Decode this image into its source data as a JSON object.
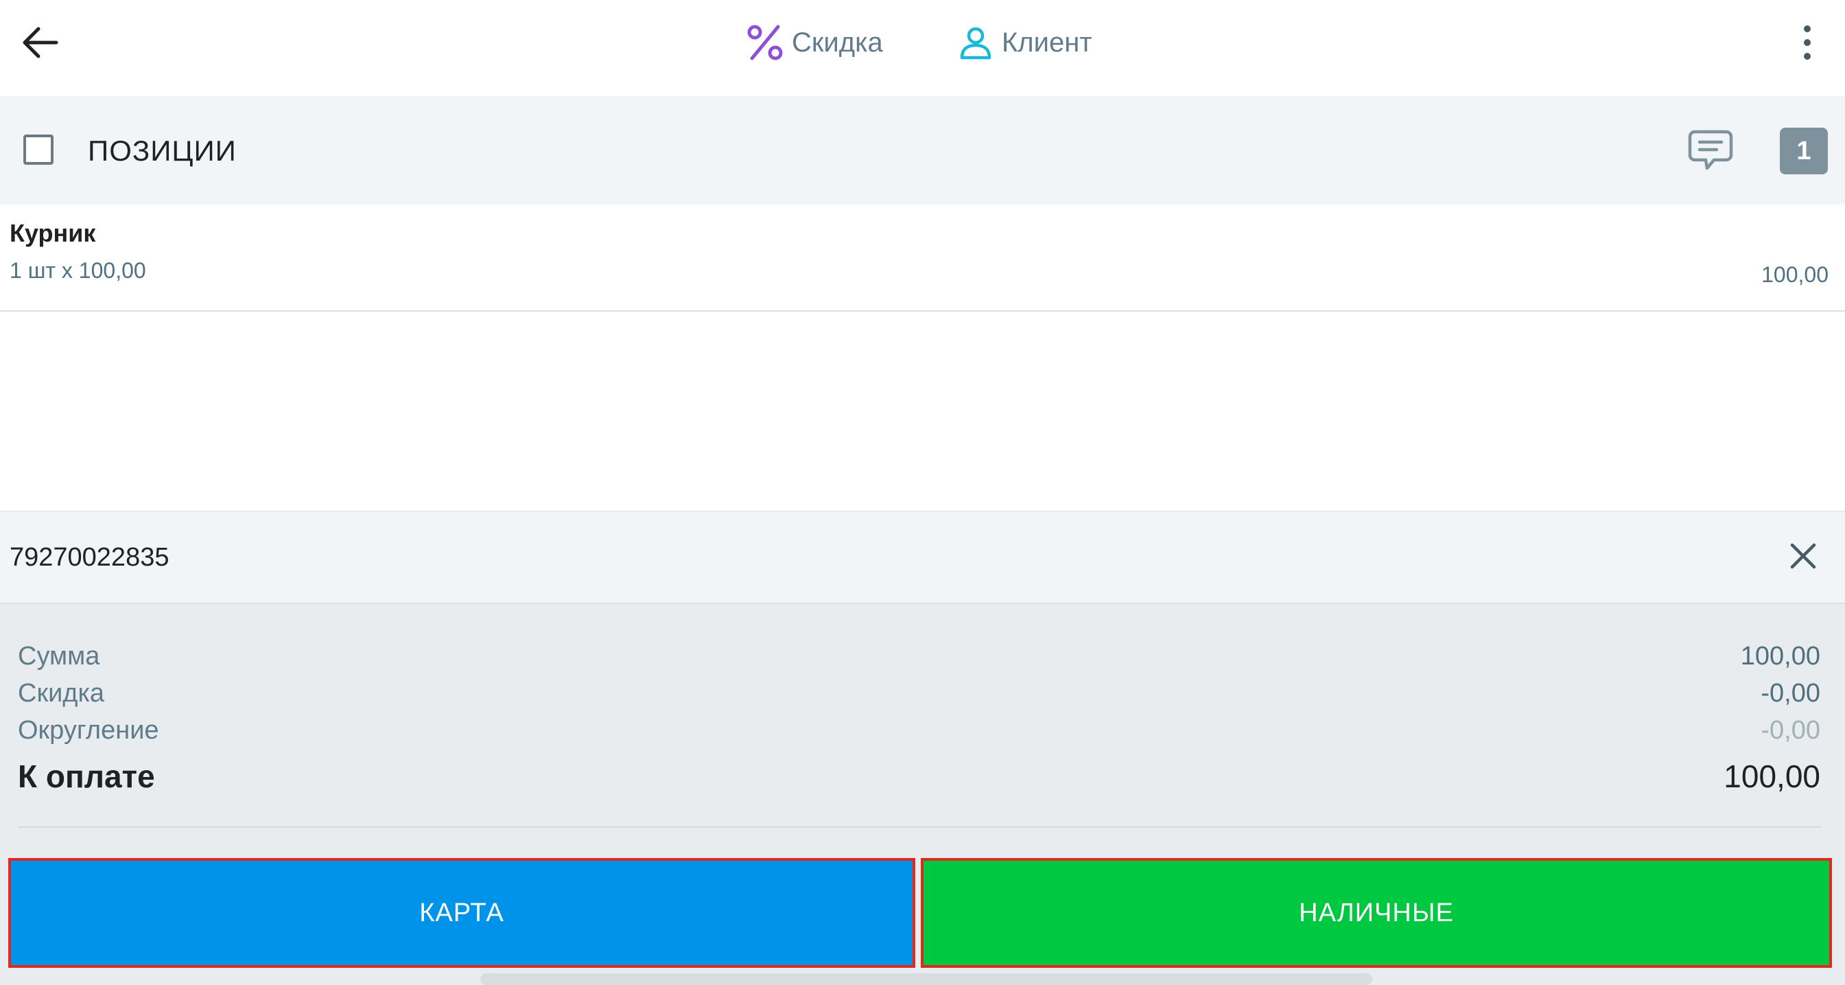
{
  "topbar": {
    "discount_label": "Скидка",
    "client_label": "Клиент",
    "icons": {
      "back": "arrow-left-icon",
      "discount": "percent-icon",
      "client": "person-icon",
      "menu": "more-vertical-icon"
    },
    "colors": {
      "discount_icon": "#8e50d8",
      "client_icon": "#17b8d8"
    }
  },
  "positions": {
    "title": "ПОЗИЦИИ",
    "count": "1",
    "items": [
      {
        "name": "Курник",
        "qty_price": "1 шт х 100,00",
        "sum": "100,00"
      }
    ]
  },
  "client": {
    "phone": "79270022835"
  },
  "totals": {
    "sum_label": "Сумма",
    "sum_value": "100,00",
    "discount_label": "Скидка",
    "discount_value": "-0,00",
    "rounding_label": "Округление",
    "rounding_value": "-0,00",
    "due_label": "К оплате",
    "due_value": "100,00"
  },
  "payment": {
    "card_label": "КАРТА",
    "cash_label": "НАЛИЧНЫЕ",
    "colors": {
      "card": "#0093ea",
      "cash": "#00c841",
      "highlight": "#e0281c"
    }
  }
}
